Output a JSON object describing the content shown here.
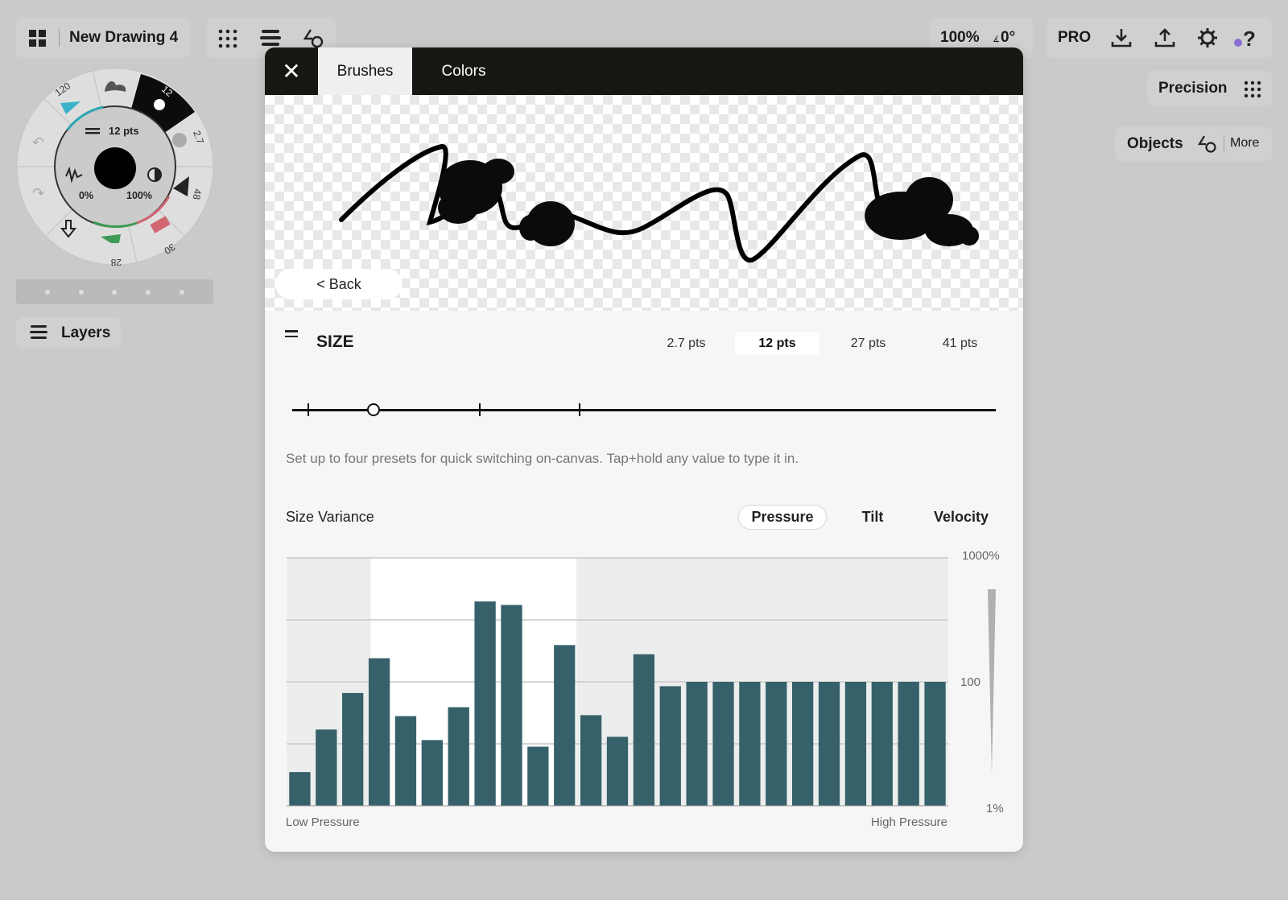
{
  "topbar": {
    "title": "New Drawing 4",
    "zoom": "100%",
    "rotation": "0°",
    "pro": "PRO"
  },
  "right_panel": {
    "precision": "Precision",
    "objects": "Objects",
    "more": "More"
  },
  "wheel": {
    "size": "12 pts",
    "opacity_min": "0%",
    "opacity_max": "100%",
    "presets": [
      "120",
      "12",
      "2.7",
      "48",
      "30",
      "28"
    ]
  },
  "layers": {
    "label": "Layers"
  },
  "modal": {
    "tabs": [
      "Brushes",
      "Colors"
    ],
    "active_tab": "Brushes",
    "back": "< Back",
    "size": {
      "title": "SIZE",
      "presets": [
        "2.7 pts",
        "12 pts",
        "27 pts",
        "41 pts"
      ],
      "selected": "12 pts",
      "help": "Set up to four presets for quick switching on-canvas. Tap+hold any value to type it in."
    },
    "variance": {
      "label": "Size Variance",
      "modes": [
        "Pressure",
        "Tilt",
        "Velocity"
      ],
      "selected": "Pressure"
    }
  },
  "chart_data": {
    "type": "bar",
    "scale": "log",
    "y_ticks": [
      "1000%",
      "100",
      "1%"
    ],
    "ylim": [
      1,
      1000
    ],
    "xlabel_left": "Low Pressure",
    "xlabel_right": "High Pressure",
    "values": [
      3.5,
      17,
      66,
      155,
      28,
      11.5,
      39,
      445,
      417,
      9,
      198,
      29,
      13,
      167,
      85,
      100,
      100,
      100,
      100,
      100,
      100,
      100,
      100,
      100,
      100
    ],
    "highlight_range": [
      0.127,
      0.438
    ],
    "bar_color": "#37616a"
  }
}
